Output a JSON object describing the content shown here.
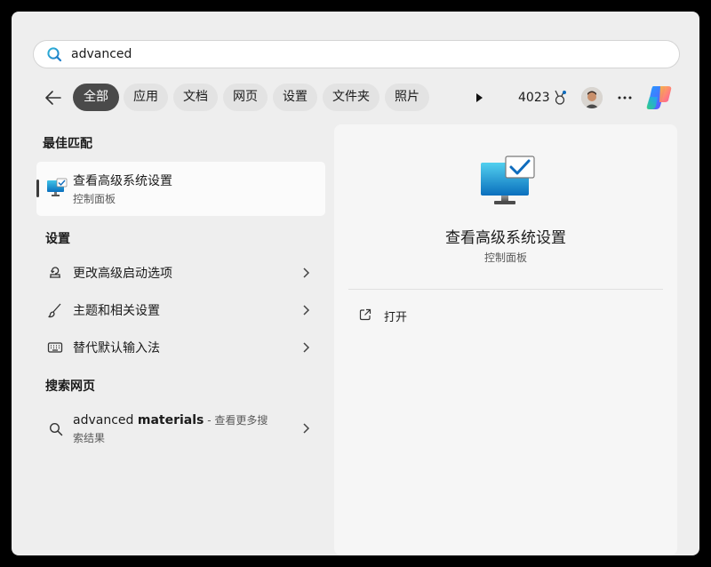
{
  "search": {
    "query": "advanced"
  },
  "filters": [
    "全部",
    "应用",
    "文档",
    "网页",
    "设置",
    "文件夹",
    "照片"
  ],
  "toolbar": {
    "points": "4023"
  },
  "best_match": {
    "heading": "最佳匹配",
    "title": "查看高级系统设置",
    "subtitle": "控制面板"
  },
  "settings": {
    "heading": "设置",
    "items": [
      {
        "label": "更改高级启动选项",
        "icon": "recovery-icon"
      },
      {
        "label": "主题和相关设置",
        "icon": "brush-icon"
      },
      {
        "label": "替代默认输入法",
        "icon": "keyboard-icon"
      }
    ]
  },
  "web": {
    "heading": "搜索网页",
    "prefix": "advanced ",
    "bold": "materials",
    "suffix": " - 查看更多搜索结果"
  },
  "preview": {
    "title": "查看高级系统设置",
    "subtitle": "控制面板",
    "actions": [
      {
        "label": "打开",
        "icon": "open-external-icon"
      }
    ]
  },
  "colors": {
    "active_chip": "#4a4a4a",
    "accent_blue": "#0f6cbd"
  }
}
